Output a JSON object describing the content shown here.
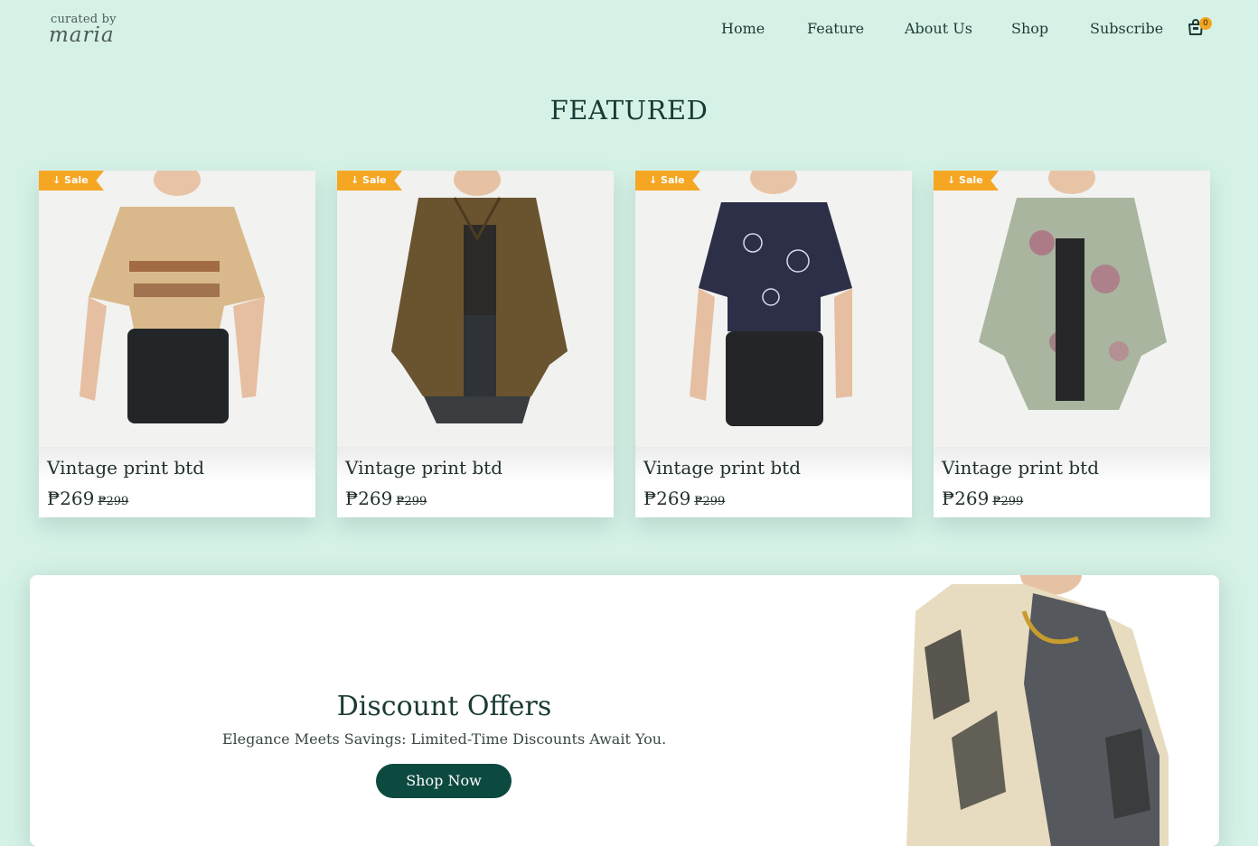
{
  "brand": {
    "line1": "curated by",
    "line2": "maria"
  },
  "nav": {
    "items": [
      "Home",
      "Feature",
      "About Us",
      "Shop",
      "Subscribe"
    ],
    "cart_count": "0"
  },
  "featured": {
    "title": "FEATURED",
    "products": [
      {
        "badge": "Sale",
        "name": "Vintage print btd",
        "price": "₱269",
        "old_price": "₱299"
      },
      {
        "badge": "Sale",
        "name": "Vintage print btd",
        "price": "₱269",
        "old_price": "₱299"
      },
      {
        "badge": "Sale",
        "name": "Vintage print btd",
        "price": "₱269",
        "old_price": "₱299"
      },
      {
        "badge": "Sale",
        "name": "Vintage print btd",
        "price": "₱269",
        "old_price": "₱299"
      }
    ]
  },
  "discount": {
    "title": "Discount Offers",
    "subtitle": "Elegance Meets Savings: Limited-Time Discounts Await You.",
    "button": "Shop Now"
  },
  "colors": {
    "background": "#d6f2e7",
    "accent_dark": "#0c4a40",
    "sale_badge": "#f5a623",
    "cart_badge": "#f2a623"
  },
  "icons": {
    "cart": "shopping-bag-icon",
    "badge_arrow": "arrow-down-icon"
  }
}
